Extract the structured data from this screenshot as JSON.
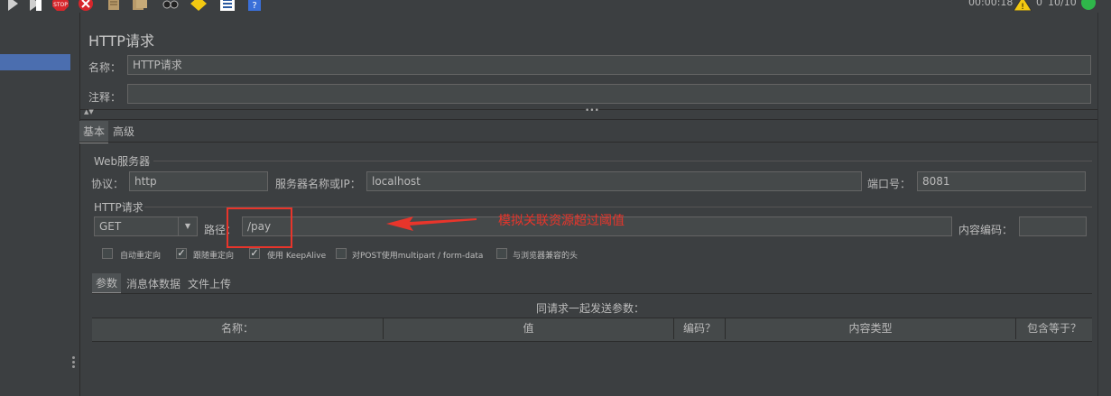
{
  "status": {
    "timer": "00:00:18",
    "warning_count": "0",
    "thread_count": "10/10"
  },
  "panel": {
    "title": "HTTP请求"
  },
  "name_row": {
    "label": "名称：",
    "value": "HTTP请求"
  },
  "comment_row": {
    "label": "注释：",
    "value": ""
  },
  "tabs": {
    "basic": "基本",
    "advanced": "高级"
  },
  "web_server": {
    "group_title": "Web服务器",
    "protocol_label": "协议：",
    "protocol_value": "http",
    "server_label": "服务器名称或IP：",
    "server_value": "localhost",
    "port_label": "端口号：",
    "port_value": "8081"
  },
  "http_request": {
    "group_title": "HTTP请求",
    "method": "GET",
    "path_label": "路径：",
    "path_value": "/pay",
    "encoding_label": "内容编码：",
    "encoding_value": ""
  },
  "options": [
    {
      "label": "自动重定向",
      "checked": false
    },
    {
      "label": "跟随重定向",
      "checked": true
    },
    {
      "label": "使用 KeepAlive",
      "checked": true
    },
    {
      "label": "对POST使用multipart / form-data",
      "checked": false
    },
    {
      "label": "与浏览器兼容的头",
      "checked": false
    }
  ],
  "param_tabs": {
    "params": "参数",
    "body": "消息体数据",
    "files": "文件上传"
  },
  "params_table": {
    "caption": "同请求一起发送参数：",
    "columns": [
      "名称：",
      "值",
      "编码？",
      "内容类型",
      "包含等于？"
    ]
  },
  "annotation": {
    "text": "模拟关联资源超过阈值",
    "color": "#e8352b"
  },
  "colors": {
    "selection": "#4b6eaf",
    "background": "#3c3f41",
    "field": "#45494a"
  }
}
